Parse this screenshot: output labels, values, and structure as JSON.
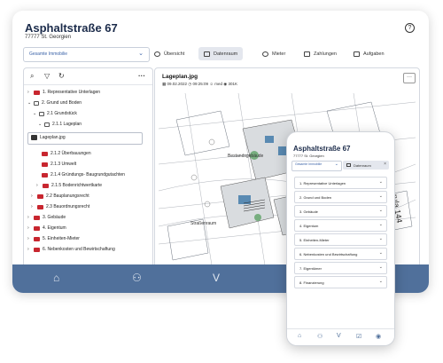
{
  "tablet": {
    "title": "Asphaltstraße 67",
    "subtitle": "77777 St. Georgien",
    "property_select": "Gesamte Immobilie",
    "tabs": [
      "Übersicht",
      "Datenraum",
      "Mieter",
      "Zahlungen",
      "Aufgaben"
    ],
    "active_tab": "Datenraum",
    "tree": [
      "1. Representative Unterlagen",
      "2. Grund und Boden",
      "2.1 Grundstück",
      "2.1.1 Lageplan",
      "Lageplan.jpg",
      "2.1.2 Überbauungen",
      "2.1.3 Umwelt",
      "2.1.4 Gründungs- Baugrundgutachten",
      "2.1.5 Bodenrichtwertkarte",
      "2.2 Bauplanungsrecht",
      "2.3 Bauordnungsrecht",
      "3. Gebäude",
      "4. Eigentum",
      "5. Einheiten-Mieter",
      "6. Nebenkosten und Bewirtschaftung"
    ],
    "file": {
      "name": "Lageplan.jpg",
      "date": "09.02.2022",
      "time": "09:25:09",
      "user": "med",
      "size": "301K"
    },
    "plan_labels": {
      "a": "Bestandsgebäude",
      "b": "Straßenraum",
      "c": "rula 144"
    }
  },
  "phone": {
    "title": "Asphaltstraße 67",
    "subtitle": "77777 St. Georgien",
    "property_select": "Gesamte Immobilie",
    "tab": "Datenraum",
    "items": [
      "1. Representative Unterlagen",
      "2. Grund und Boden",
      "3. Gebäude",
      "4. Eigentum",
      "5. Einheiten-Mieter",
      "6. Nebenkosten und Bewirtschaftung",
      "7. Eigentümer",
      "8. Finanzierung"
    ]
  },
  "icons": [
    "help-icon",
    "search-icon",
    "filter-icon",
    "refresh-icon",
    "more-icon",
    "home-icon",
    "users-icon",
    "logo-icon",
    "calendar-icon",
    "clock-icon",
    "user-icon",
    "size-icon"
  ],
  "colors": {
    "navy": "#1b2b4a",
    "accent_blue": "#3b63a8",
    "bottom_bar": "#50709b",
    "folder_red": "#c8262f"
  }
}
